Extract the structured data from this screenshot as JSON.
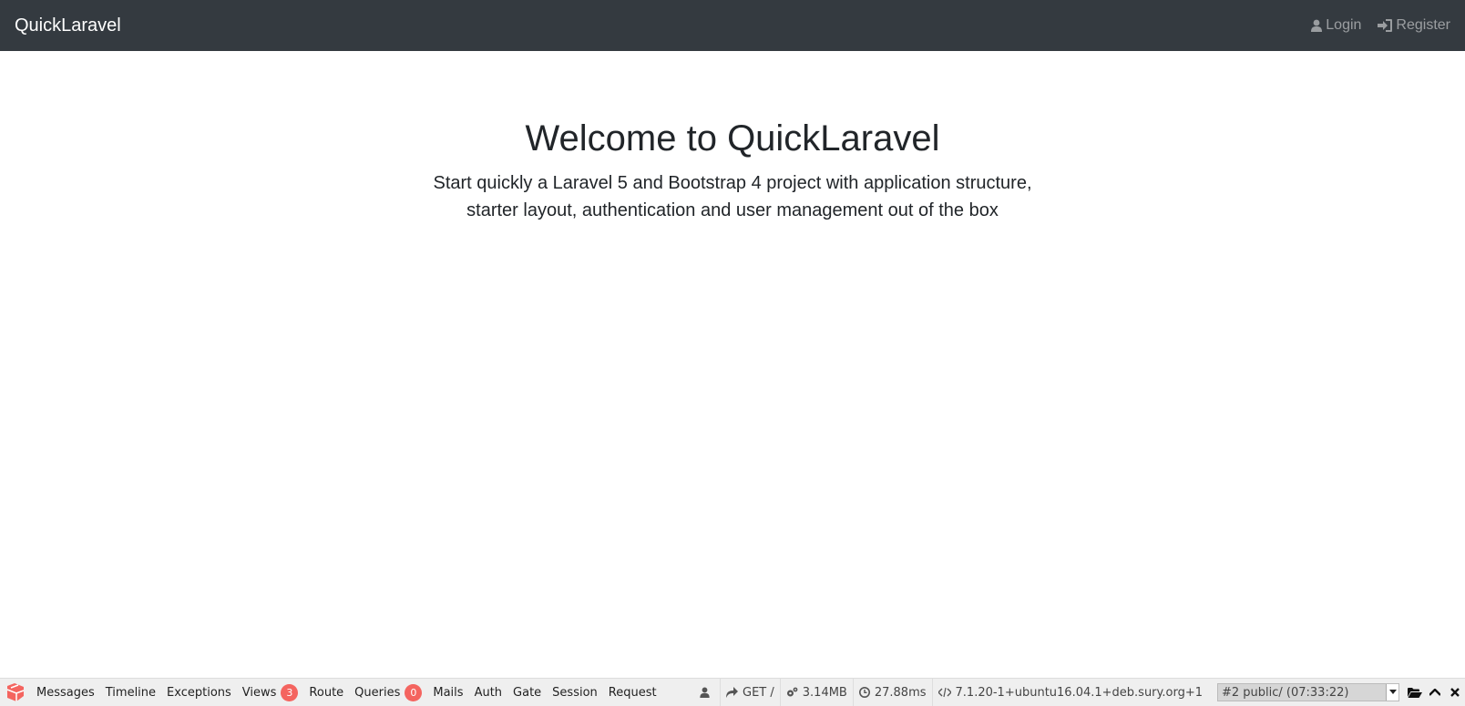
{
  "navbar": {
    "brand": "QuickLaravel",
    "login_label": "Login",
    "register_label": "Register"
  },
  "hero": {
    "title": "Welcome to QuickLaravel",
    "subtitle_line1": "Start quickly a Laravel 5 and Bootstrap 4 project with application structure,",
    "subtitle_line2": "starter layout, authentication and user management out of the box"
  },
  "debugbar": {
    "tabs": {
      "messages": "Messages",
      "timeline": "Timeline",
      "exceptions": "Exceptions",
      "views": "Views",
      "views_badge": "3",
      "route": "Route",
      "queries": "Queries",
      "queries_badge": "0",
      "mails": "Mails",
      "auth": "Auth",
      "gate": "Gate",
      "session": "Session",
      "request": "Request"
    },
    "indicators": {
      "route": "GET /",
      "memory": "3.14MB",
      "time": "27.88ms",
      "php_version": "7.1.20-1+ubuntu16.04.1+deb.sury.org+1"
    },
    "dataset_select": "#2 public/ (07:33:22)"
  },
  "colors": {
    "navbar_bg": "#343a40",
    "badge_bg": "#f4645f",
    "debugbar_bg": "#efefef"
  }
}
